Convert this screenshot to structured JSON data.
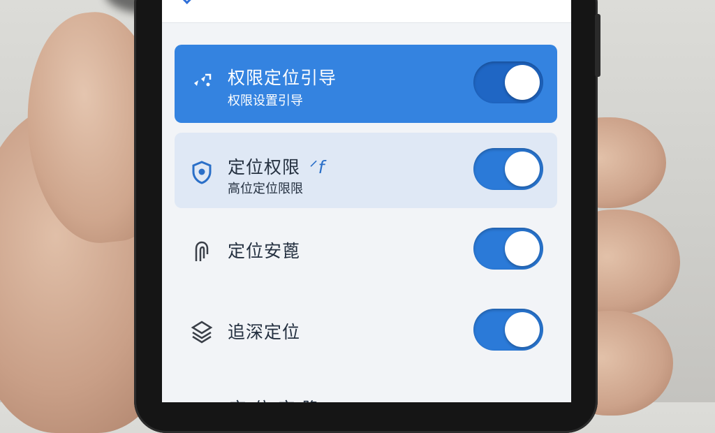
{
  "settings": {
    "items": [
      {
        "title": "权限定位引导",
        "subtitle": "权限设置引导",
        "icon": "sparkle-icon",
        "toggle_on": true,
        "style": "active"
      },
      {
        "title": "定位权限",
        "title_suffix": "ᐟf",
        "subtitle": "高位定位限限",
        "icon": "shield-icon",
        "toggle_on": true,
        "style": "soft"
      },
      {
        "title": "定位安蓖",
        "subtitle": "",
        "icon": "fingerprint-icon",
        "toggle_on": true,
        "style": "plain"
      },
      {
        "title": "追深定位",
        "subtitle": "",
        "icon": "layers-icon",
        "toggle_on": true,
        "style": "plain"
      }
    ],
    "peek_text": "定 位 定 隐"
  },
  "colors": {
    "accent": "#3483e0",
    "toggle": "#2b7ad8",
    "soft_row": "#dfe8f5",
    "screen_bg": "#f2f4f7"
  }
}
